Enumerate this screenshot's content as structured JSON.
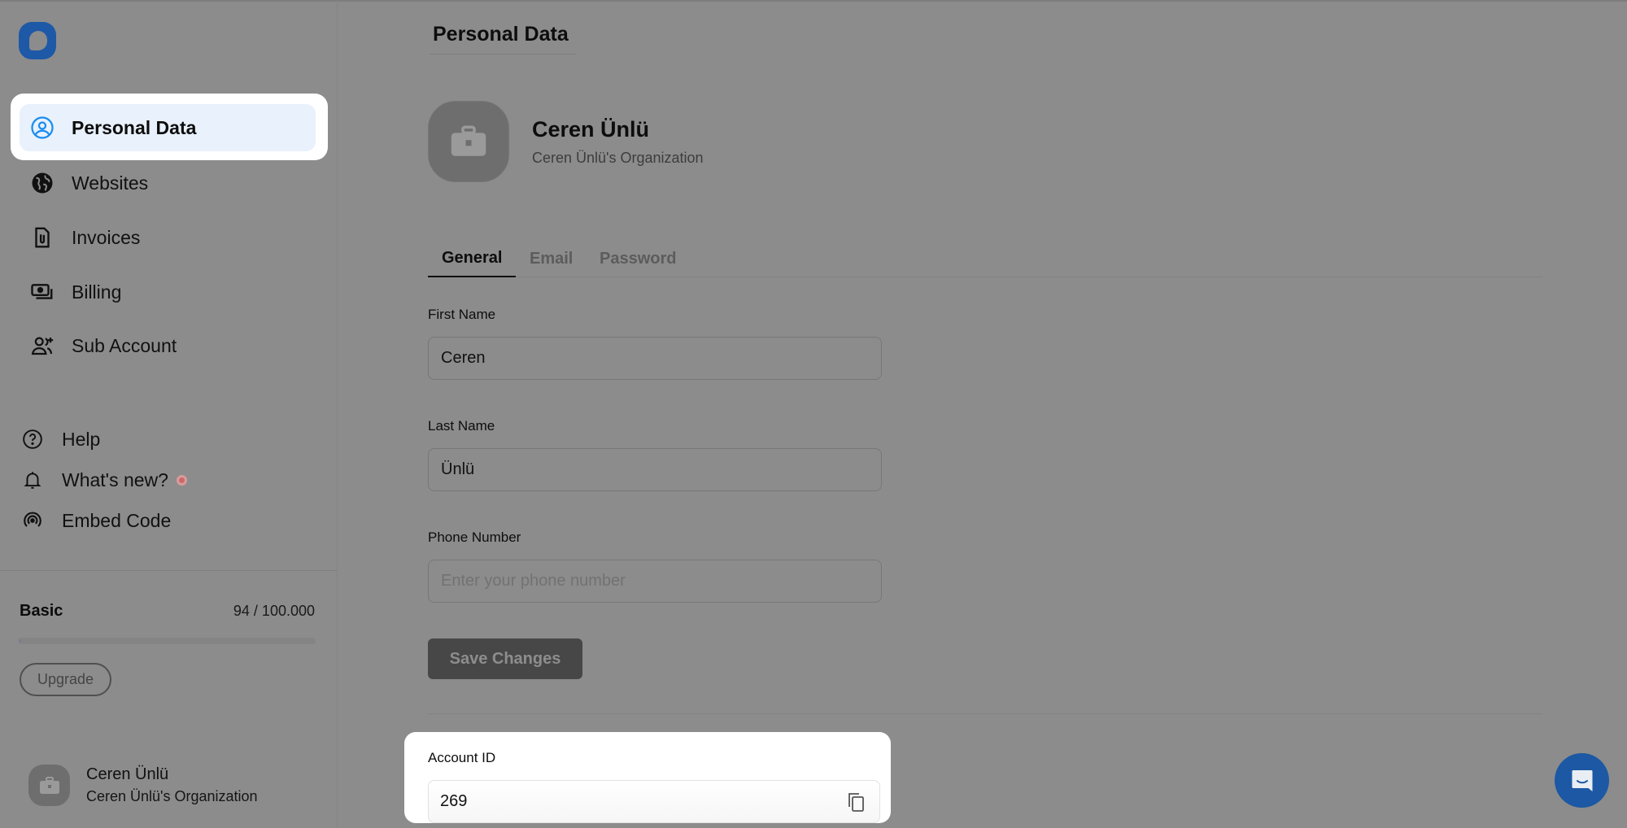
{
  "app": {
    "logo_icon": "chat-bubble-logo"
  },
  "sidebar": {
    "nav_items": [
      {
        "label": "Personal Data",
        "icon": "user-circle-icon",
        "active": true
      },
      {
        "label": "Websites",
        "icon": "globe-icon",
        "active": false
      },
      {
        "label": "Invoices",
        "icon": "document-clip-icon",
        "active": false
      },
      {
        "label": "Billing",
        "icon": "banknotes-icon",
        "active": false
      },
      {
        "label": "Sub Account",
        "icon": "user-plus-icon",
        "active": false
      }
    ],
    "utility_items": [
      {
        "label": "Help",
        "icon": "question-circle-icon"
      },
      {
        "label": "What's new?",
        "icon": "bell-icon",
        "has_notification": true
      },
      {
        "label": "Embed Code",
        "icon": "signal-icon"
      }
    ],
    "plan": {
      "name": "Basic",
      "usage_text": "94 / 100.000",
      "used": 94,
      "limit": 100000,
      "upgrade_label": "Upgrade"
    },
    "account": {
      "name": "Ceren Ünlü",
      "organization": "Ceren Ünlü's Organization",
      "avatar_icon": "briefcase-icon"
    }
  },
  "main": {
    "page_title": "Personal Data",
    "profile": {
      "name": "Ceren Ünlü",
      "organization": "Ceren Ünlü's Organization",
      "avatar_icon": "briefcase-icon"
    },
    "tabs": [
      {
        "label": "General",
        "active": true
      },
      {
        "label": "Email",
        "active": false
      },
      {
        "label": "Password",
        "active": false
      }
    ],
    "form": {
      "first_name": {
        "label": "First Name",
        "value": "Ceren",
        "placeholder": ""
      },
      "last_name": {
        "label": "Last Name",
        "value": "Ünlü",
        "placeholder": ""
      },
      "phone": {
        "label": "Phone Number",
        "value": "",
        "placeholder": "Enter your phone number"
      },
      "save_label": "Save Changes"
    },
    "account_id": {
      "label": "Account ID",
      "value": "269",
      "copy_icon": "copy-icon"
    }
  },
  "chat_widget": {
    "icon": "chat-icon"
  },
  "colors": {
    "overlay": "#8c8c8c",
    "accent_blue": "#1d59a6",
    "active_nav_bg": "#e8f1fc",
    "active_icon": "#1a8cf0",
    "notification": "#c96a6a",
    "save_button": "#474747"
  }
}
